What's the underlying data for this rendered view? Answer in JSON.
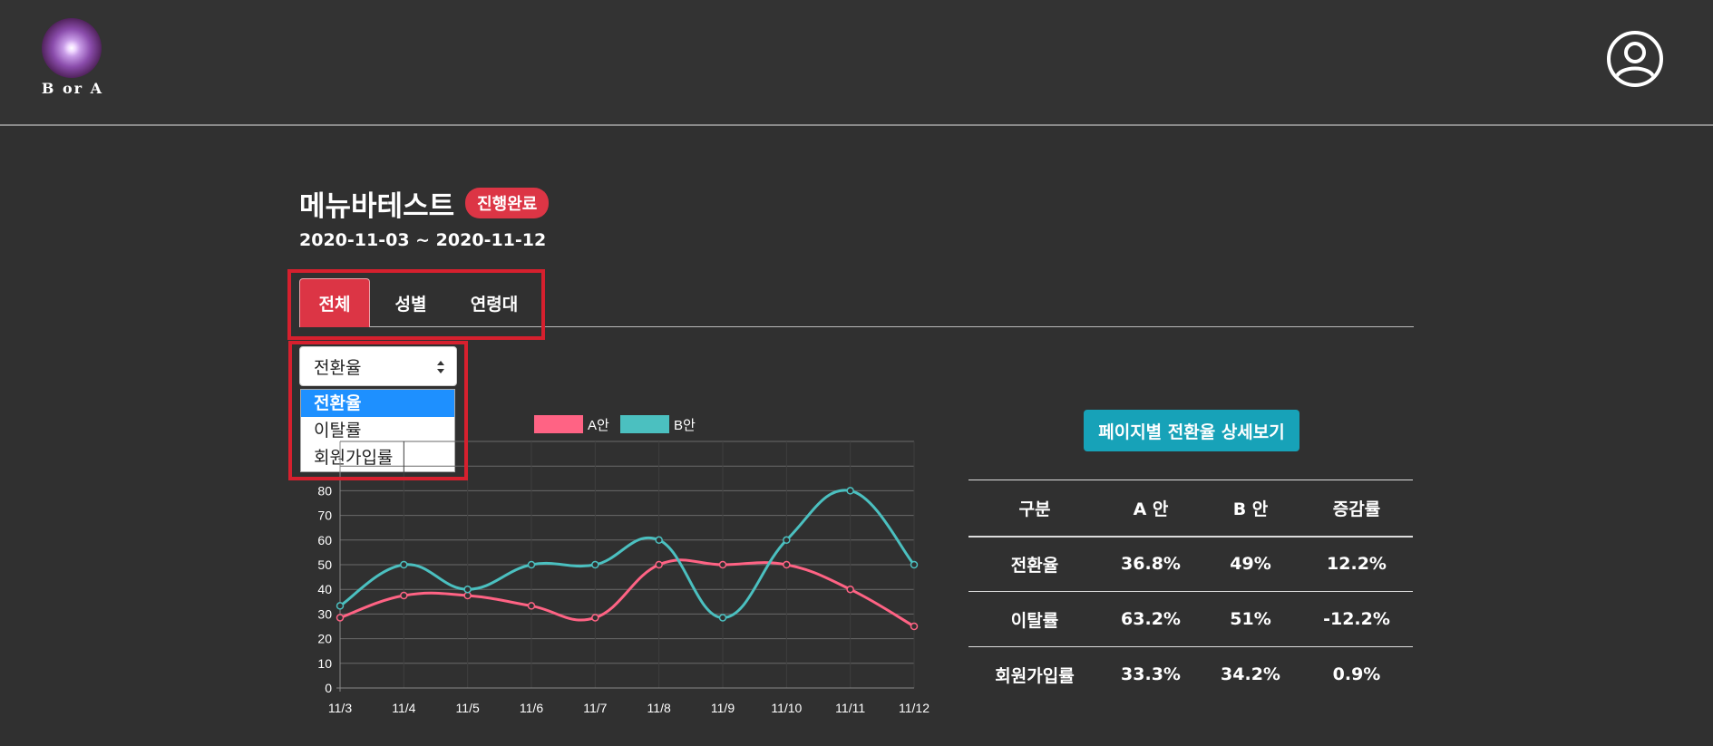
{
  "app": {
    "logo_text": "B or A",
    "user_icon": "user-circle-icon"
  },
  "experiment": {
    "title": "메뉴바테스트",
    "status": "진행완료",
    "date_range": "2020-11-03 ~ 2020-11-12"
  },
  "tabs": [
    {
      "label": "전체",
      "active": true
    },
    {
      "label": "성별",
      "active": false
    },
    {
      "label": "연령대",
      "active": false
    }
  ],
  "metric_select": {
    "value": "전환율",
    "options": [
      "전환율",
      "이탈률",
      "회원가입률"
    ]
  },
  "detail_button": "페이지별 전환율 상세보기",
  "colors": {
    "accent_red": "#dc3545",
    "accent_teal": "#17a2b8",
    "series_a": "#ff6384",
    "series_b": "#4bc0c0",
    "highlight": "#d6202e"
  },
  "chart_data": {
    "type": "line",
    "categories": [
      "11/3",
      "11/4",
      "11/5",
      "11/6",
      "11/7",
      "11/8",
      "11/9",
      "11/10",
      "11/11",
      "11/12"
    ],
    "series": [
      {
        "name": "A안",
        "values": [
          28.5,
          37.5,
          37.5,
          33.3,
          28.5,
          50,
          50,
          50,
          40,
          25
        ]
      },
      {
        "name": "B안",
        "values": [
          33.3,
          50,
          40,
          50,
          50,
          60,
          28.5,
          60,
          80,
          50
        ]
      }
    ],
    "yticks": [
      0,
      10,
      20,
      30,
      40,
      50,
      60,
      70,
      80
    ],
    "ylim": [
      0,
      100
    ],
    "grid": true,
    "legend": "top"
  },
  "table": {
    "headers": [
      "구분",
      "A 안",
      "B 안",
      "증감률"
    ],
    "rows": [
      [
        "전환율",
        "36.8%",
        "49%",
        "12.2%"
      ],
      [
        "이탈률",
        "63.2%",
        "51%",
        "-12.2%"
      ],
      [
        "회원가입률",
        "33.3%",
        "34.2%",
        "0.9%"
      ]
    ]
  }
}
